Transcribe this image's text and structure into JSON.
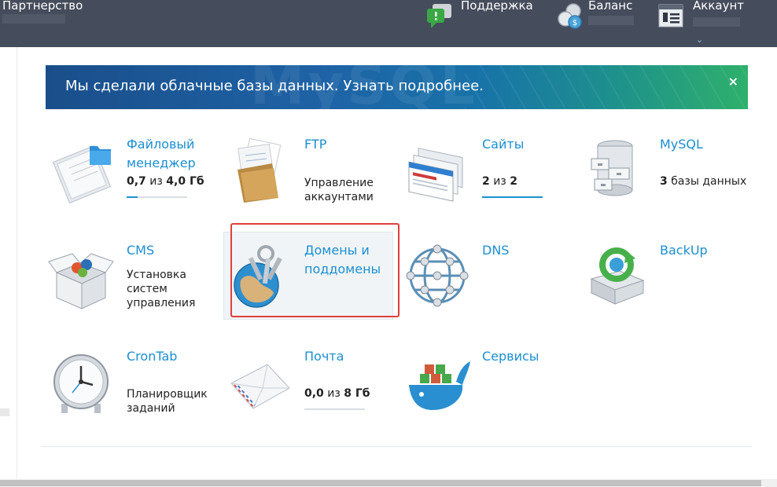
{
  "topbar": {
    "partner_label": "Партнерство",
    "support_label": "Поддержка",
    "balance_label": "Баланс",
    "account_label": "Аккаунт",
    "account_chevron": "⌄"
  },
  "banner": {
    "text": "Мы сделали облачные базы данных. Узнать подробнее.",
    "close": "×",
    "watermark": "MySQL"
  },
  "tiles": {
    "files": {
      "name1": "Файловый",
      "name2": "менеджер",
      "used": "0,7",
      "of": "из",
      "total": "4,0 Гб",
      "usage": 0.18
    },
    "ftp": {
      "name": "FTP",
      "desc1": "Управление",
      "desc2": "аккаунтами"
    },
    "sites": {
      "name": "Сайты",
      "used": "2",
      "of": "из",
      "total": "2",
      "usage": 1.0
    },
    "mysql": {
      "name": "MySQL",
      "count": "3",
      "desc": "базы данных"
    },
    "cms": {
      "name": "CMS",
      "desc1": "Установка",
      "desc2": "систем",
      "desc3": "управления"
    },
    "domains": {
      "name1": "Домены и",
      "name2": "поддомены"
    },
    "dns": {
      "name": "DNS"
    },
    "backup": {
      "name": "BackUp"
    },
    "crontab": {
      "name": "CronTab",
      "desc1": "Планировщик",
      "desc2": "заданий"
    },
    "mail": {
      "name": "Почта",
      "used": "0,0",
      "of": "из",
      "total": "8 Гб",
      "usage": 0.0
    },
    "services": {
      "name": "Сервисы"
    }
  },
  "colors": {
    "topbar": "#454c5b",
    "link": "#1b8fd0",
    "highlight_border": "#e0403a"
  }
}
